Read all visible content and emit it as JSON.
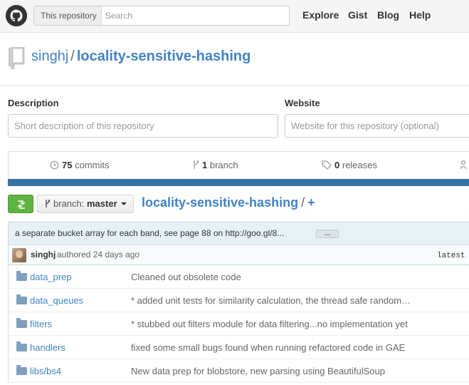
{
  "header": {
    "search_scope": "This repository",
    "search_placeholder": "Search",
    "nav": [
      "Explore",
      "Gist",
      "Blog",
      "Help"
    ]
  },
  "repo": {
    "owner": "singhj",
    "separator": "/",
    "name": "locality-sensitive-hashing"
  },
  "form": {
    "description_label": "Description",
    "description_placeholder": "Short description of this repository",
    "website_label": "Website",
    "website_placeholder": "Website for this repository (optional)"
  },
  "stats": {
    "commits_count": "75",
    "commits_label": "commits",
    "branches_count": "1",
    "branches_label": "branch",
    "releases_count": "0",
    "releases_label": "releases"
  },
  "branch_bar": {
    "branch_label": "branch:",
    "branch_value": "master",
    "breadcrumb_repo": "locality-sensitive-hashing",
    "breadcrumb_sep": "/",
    "breadcrumb_add": "+"
  },
  "commit": {
    "message": "a separate bucket array for each band, see page 88 on http://goo.gl/8...",
    "ellipsis": "…",
    "author": "singhj",
    "action": "authored 24 days ago",
    "sha_label": "latest"
  },
  "files": [
    {
      "name": "data_prep",
      "message": "Cleaned out obsolete code"
    },
    {
      "name": "data_queues",
      "message": "* added unit tests for similarity calculation, the thread safe random…"
    },
    {
      "name": "filters",
      "message": "* stubbed out filters module for data filtering...no implementation yet"
    },
    {
      "name": "handlers",
      "message": "fixed some small bugs found when running refactored code in GAE"
    },
    {
      "name": "libs/bs4",
      "message": "New data prep for blobstore, new parsing using BeautifulSoup"
    }
  ],
  "colors": {
    "link": "#4183c4",
    "accent_green": "#5fb341",
    "language_bar": "#3572a5"
  }
}
